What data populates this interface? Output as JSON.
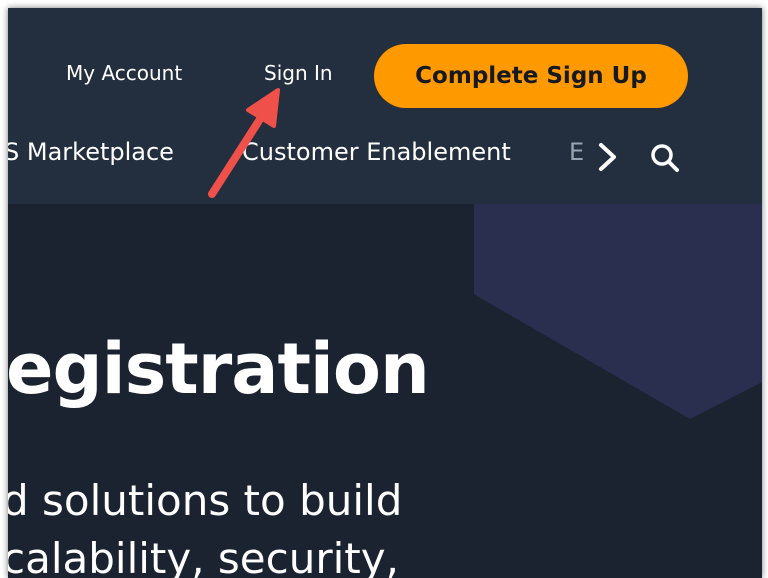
{
  "header": {
    "my_account": "My Account",
    "sign_in": "Sign In",
    "complete_sign_up": "Complete Sign Up"
  },
  "subnav": {
    "items": [
      "S Marketplace",
      "Customer Enablement",
      "E"
    ],
    "next_icon": "chevron-right-icon",
    "search_icon": "search-icon"
  },
  "hero": {
    "title": "egistration",
    "text_lines": [
      "d solutions to build",
      "calability, security,"
    ]
  },
  "annotation": {
    "arrow_icon": "arrow-pointer-icon",
    "arrow_color": "#f0504a"
  },
  "colors": {
    "header_bg": "#232f3e",
    "cta_bg": "#ff9900",
    "hero_bg": "#1b2230"
  }
}
